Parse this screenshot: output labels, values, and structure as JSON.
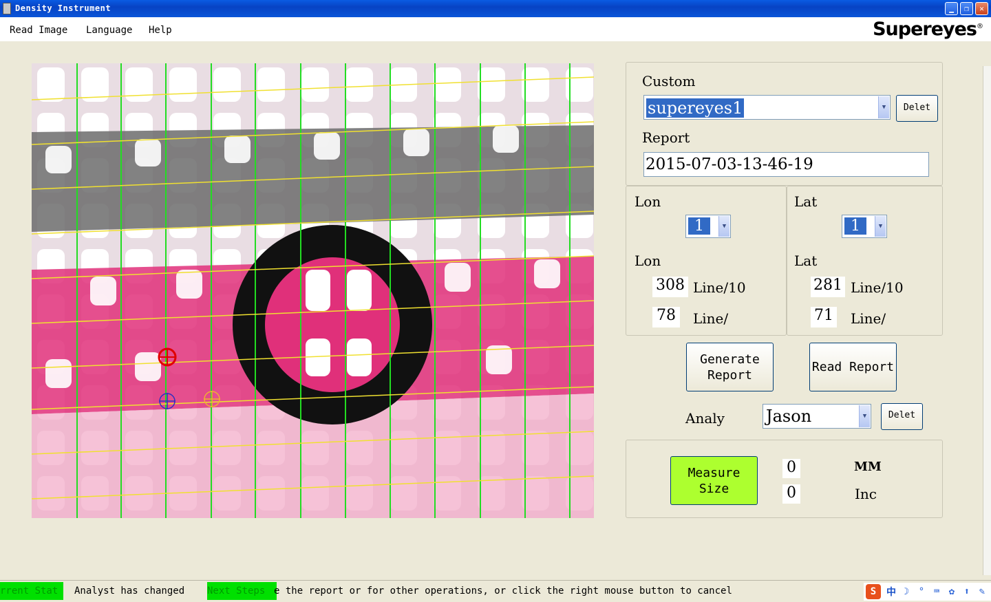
{
  "window": {
    "title": "Density Instrument"
  },
  "menu": {
    "items": [
      "Read Image",
      "Language",
      "Help"
    ],
    "logo": "Supereyes",
    "logo_mark": "®"
  },
  "panel": {
    "custom_label": "Custom",
    "custom_value": "supereyes1",
    "delete_label": "Delet",
    "report_label": "Report",
    "report_value": "2015-07-03-13-46-19",
    "lon": {
      "header": "Lon",
      "select_value": "1",
      "result_label": "Lon",
      "density_value": "308",
      "density_unit": "Line/10",
      "count_value": "78",
      "count_unit": "Line/"
    },
    "lat": {
      "header": "Lat",
      "select_value": "1",
      "result_label": "Lat",
      "density_value": "281",
      "density_unit": "Line/10",
      "count_value": "71",
      "count_unit": "Line/"
    },
    "generate_report_label": "Generate Report",
    "read_report_label": "Read Report",
    "analyst_label": "Analy",
    "analyst_value": "Jason",
    "analyst_delete_label": "Delet",
    "measure_size_label": "Measure Size",
    "mm_value": "0",
    "mm_unit": "MM",
    "inch_value": "0",
    "inch_unit": "Inc"
  },
  "status": {
    "current_state_label": "rrent Stat",
    "current_state_text": "Analyst has changed",
    "next_steps_label": "Next Steps",
    "next_steps_text": "e the report or for other operations, or click the right mouse button to cancel"
  },
  "colors": {
    "grid_vertical": "#22dd22",
    "grid_horizontal": "#f0e030",
    "pink_thread": "#e0307a",
    "grey_thread": "#707070",
    "measure_button": "#adff2f",
    "status_green": "#00e000"
  }
}
